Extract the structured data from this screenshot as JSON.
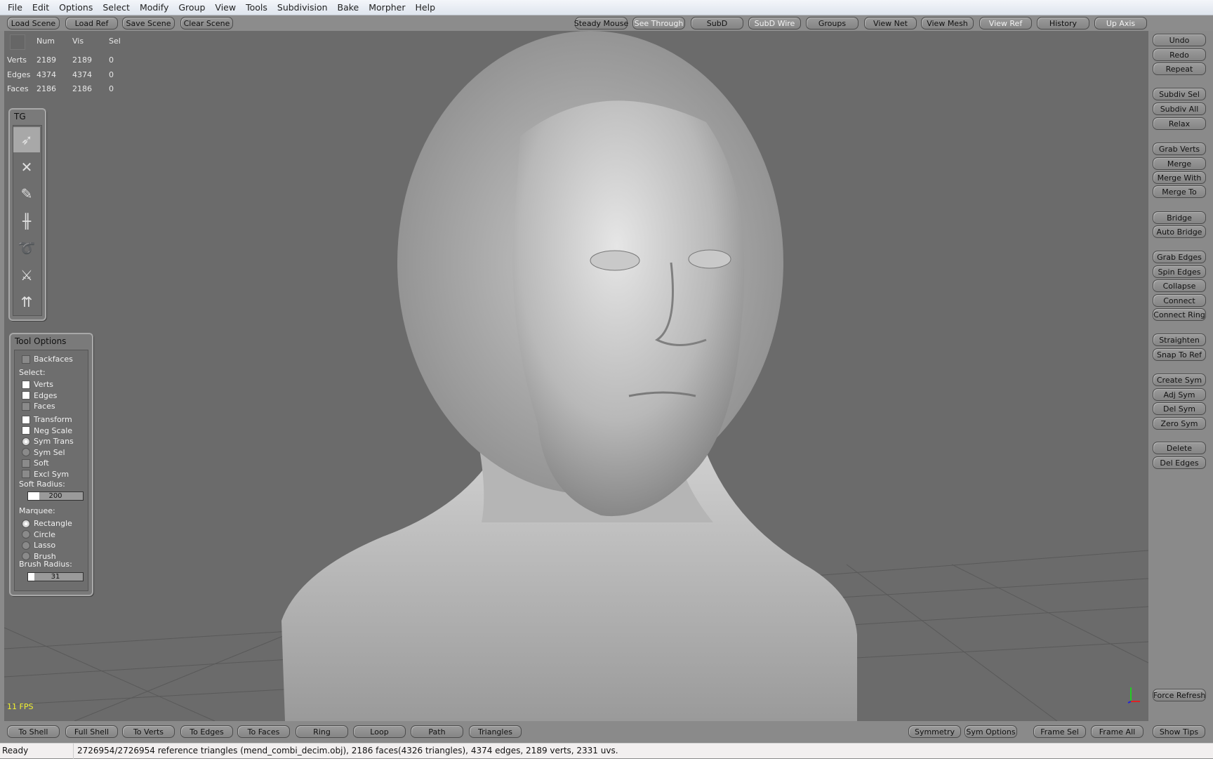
{
  "menu": [
    "File",
    "Edit",
    "Options",
    "Select",
    "Modify",
    "Group",
    "View",
    "Tools",
    "Subdivision",
    "Bake",
    "Morpher",
    "Help"
  ],
  "toolbar": {
    "left": [
      "Load Scene",
      "Load Ref",
      "Save Scene",
      "Clear Scene"
    ],
    "right": [
      {
        "label": "Steady Mouse",
        "active": false
      },
      {
        "label": "See Through",
        "active": true
      },
      {
        "label": "SubD",
        "active": false
      },
      {
        "label": "SubD Wire",
        "active": true
      },
      {
        "label": "Groups",
        "active": false
      },
      {
        "label": "View Net",
        "active": false
      },
      {
        "label": "View Mesh",
        "active": false
      },
      {
        "label": "View Ref",
        "active": true
      },
      {
        "label": "History",
        "active": false
      },
      {
        "label": "Up Axis",
        "active": true
      }
    ]
  },
  "stats": {
    "headers": [
      "Num",
      "Vis",
      "Sel"
    ],
    "rows": [
      {
        "label": "Verts",
        "num": "2189",
        "vis": "2189",
        "sel": "0"
      },
      {
        "label": "Edges",
        "num": "4374",
        "vis": "4374",
        "sel": "0"
      },
      {
        "label": "Faces",
        "num": "2186",
        "vis": "2186",
        "sel": "0"
      }
    ]
  },
  "tool_group": {
    "title": "TG",
    "tools": [
      "select-arrow-icon",
      "transform-cross-icon",
      "pencil-draw-icon",
      "bridge-icon",
      "spiral-relax-icon",
      "knife-icon",
      "extrude-edges-icon"
    ],
    "selected_index": 0
  },
  "tool_options": {
    "title": "Tool Options",
    "backfaces": {
      "label": "Backfaces",
      "checked": false
    },
    "select_label": "Select:",
    "select": [
      {
        "label": "Verts",
        "checked": true
      },
      {
        "label": "Edges",
        "checked": true
      },
      {
        "label": "Faces",
        "checked": false
      }
    ],
    "transform": [
      {
        "label": "Transform",
        "type": "checkbox",
        "checked": true
      },
      {
        "label": "Neg Scale",
        "type": "checkbox",
        "checked": true
      },
      {
        "label": "Sym Trans",
        "type": "radio",
        "checked": true
      },
      {
        "label": "Sym Sel",
        "type": "radio",
        "checked": false
      },
      {
        "label": "Soft",
        "type": "checkbox",
        "checked": false
      },
      {
        "label": "Excl Sym",
        "type": "checkbox",
        "checked": false
      }
    ],
    "soft_radius_label": "Soft Radius:",
    "soft_radius": "200",
    "marquee_label": "Marquee:",
    "marquee": [
      {
        "label": "Rectangle",
        "checked": true
      },
      {
        "label": "Circle",
        "checked": false
      },
      {
        "label": "Lasso",
        "checked": false
      },
      {
        "label": "Brush",
        "checked": false
      }
    ],
    "brush_radius_label": "Brush Radius:",
    "brush_radius": "31"
  },
  "fps": "11 FPS",
  "right_panel": [
    "Undo",
    "Redo",
    "Repeat",
    "Subdiv Sel",
    "Subdiv All",
    "Relax",
    "Grab Verts",
    "Merge",
    "Merge With",
    "Merge To",
    "Bridge",
    "Auto Bridge",
    "Grab Edges",
    "Spin Edges",
    "Collapse",
    "Connect",
    "Connect Ring",
    "Straighten",
    "Snap To Ref",
    "Create Sym",
    "Adj Sym",
    "Del Sym",
    "Zero Sym",
    "Delete",
    "Del Edges",
    "Force Refresh"
  ],
  "bottom": {
    "left": [
      "To Shell",
      "Full Shell",
      "To Verts",
      "To Edges",
      "To Faces",
      "Ring",
      "Loop",
      "Path",
      "Triangles"
    ],
    "right": [
      "Symmetry",
      "Sym Options",
      "Frame Sel",
      "Frame All",
      "Show Tips"
    ]
  },
  "status": {
    "ready": "Ready",
    "message": "2726954/2726954 reference triangles (mend_combi_decim.obj), 2186 faces(4326 triangles), 4374 edges, 2189 verts, 2331 uvs."
  },
  "colors": {
    "stat_values": "#f2f230",
    "viewport_bg": "#6b6b6b",
    "axis_y": "#22cc22",
    "axis_x": "#dd2222",
    "axis_z": "#2222dd"
  }
}
